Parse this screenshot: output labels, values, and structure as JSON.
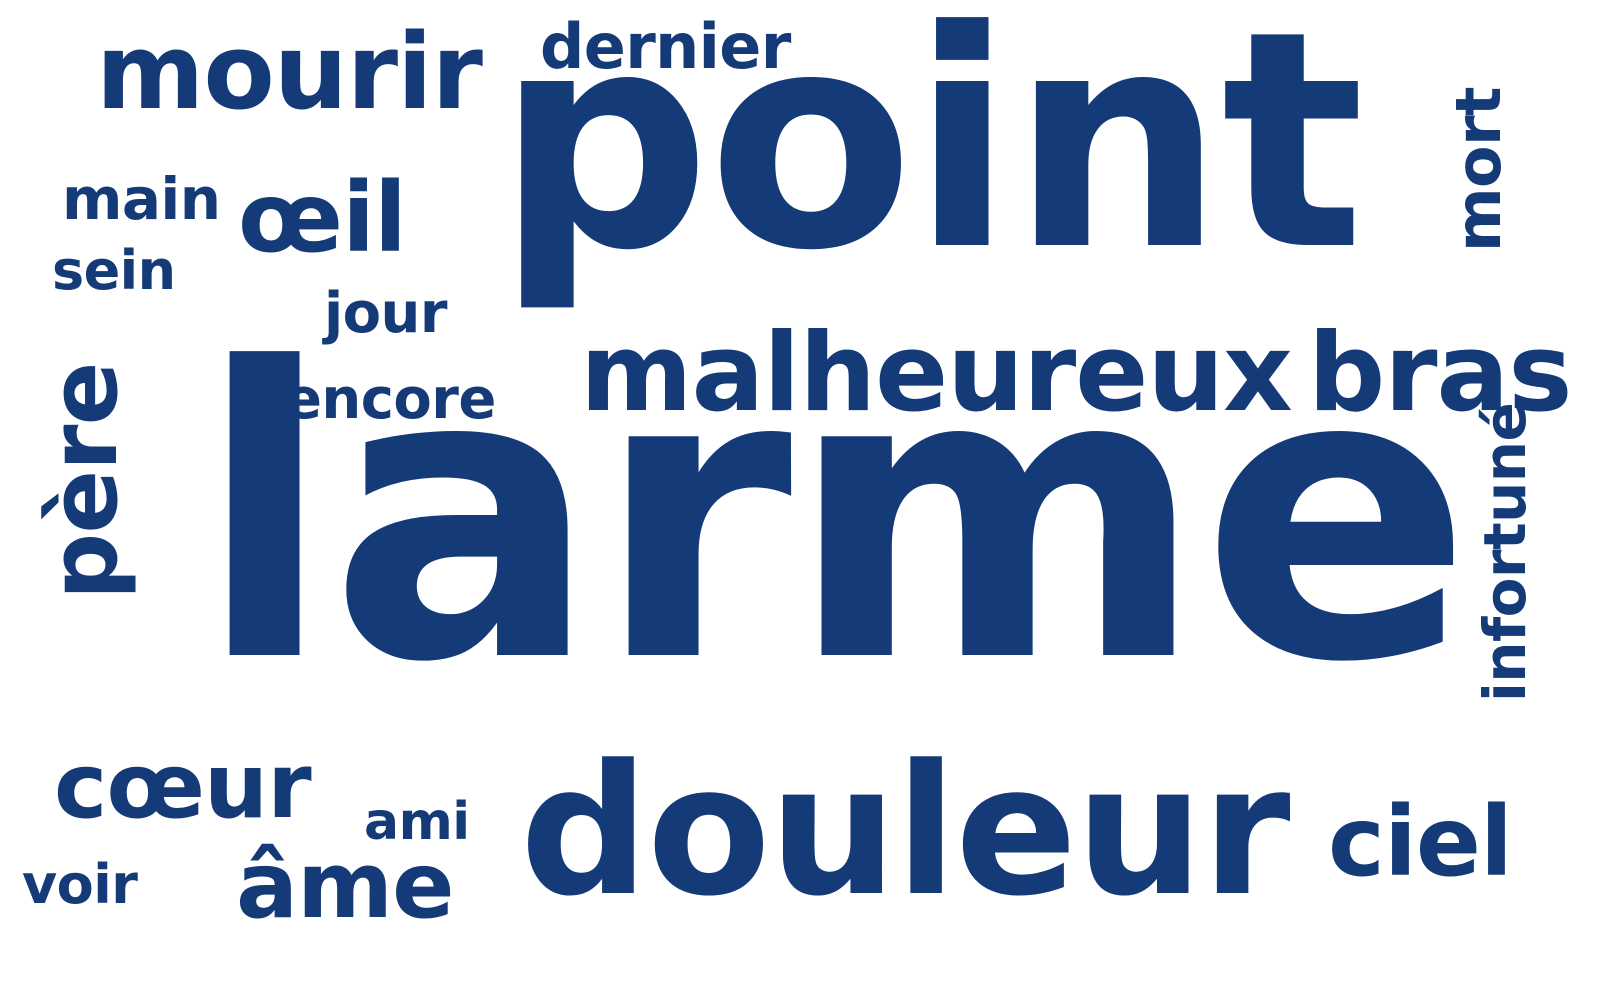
{
  "colors": {
    "background": "#ffffff",
    "word": "#143a78"
  },
  "words": {
    "larme": "larme",
    "point": "point",
    "douleur": "douleur",
    "malheureux": "malheureux",
    "bras": "bras",
    "mourir": "mourir",
    "coeur": "cœur",
    "pere": "père",
    "oeil": "œil",
    "ame": "âme",
    "ciel": "ciel",
    "mort": "mort",
    "infortune": "infortuné",
    "dernier": "dernier",
    "main": "main",
    "sein": "sein",
    "jour": "jour",
    "encore": "encore",
    "ami": "ami",
    "voir": "voir"
  }
}
